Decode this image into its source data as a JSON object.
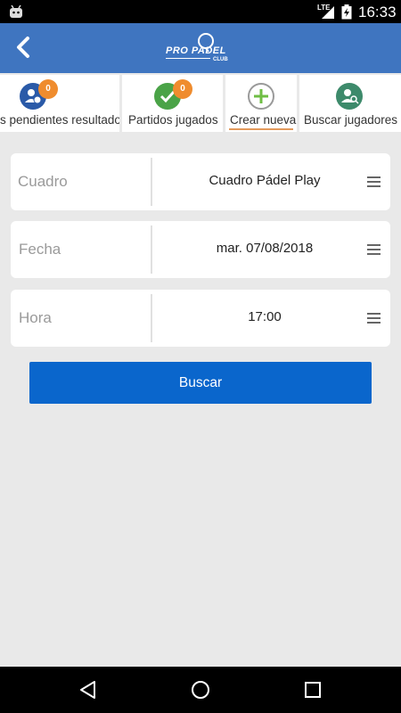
{
  "status_bar": {
    "time": "16:33",
    "network": "LTE"
  },
  "app_bar": {
    "back_icon": "chevron-left-icon",
    "logo_text": "PRO PADEL",
    "logo_sub": "CLUB"
  },
  "tabs": [
    {
      "label": "Partidos pendientes resultado",
      "visible_label": "s pendientes resultado",
      "badge": "0",
      "icon": "user-clock-icon",
      "color": "#2a5aa8"
    },
    {
      "label": "Partidos jugados",
      "badge": "0",
      "icon": "check-icon",
      "color": "#4aa347"
    },
    {
      "label": "Crear nueva",
      "icon": "plus-circle-icon",
      "color": "#6fbe44",
      "active": true
    },
    {
      "label": "Buscar jugadores",
      "icon": "user-search-icon",
      "color": "#3d8a6b"
    }
  ],
  "form": {
    "cuadro": {
      "label": "Cuadro",
      "value": "Cuadro Pádel Play"
    },
    "fecha": {
      "label": "Fecha",
      "value": "mar. 07/08/2018"
    },
    "hora": {
      "label": "Hora",
      "value": "17:00"
    },
    "search_button": "Buscar"
  },
  "colors": {
    "app_bar": "#3f75c0",
    "button": "#0a66cc",
    "badge": "#ef8c2e",
    "background": "#e9e9e9"
  }
}
